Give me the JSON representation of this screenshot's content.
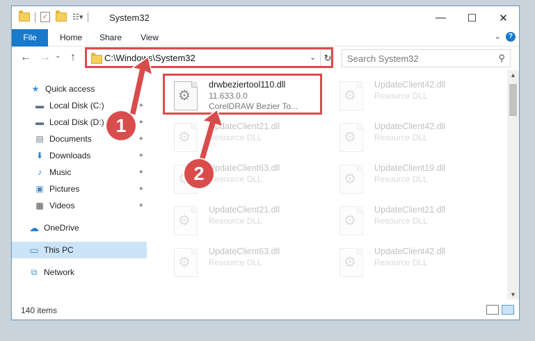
{
  "window": {
    "title": "System32",
    "controls": {
      "minimize": "—",
      "maximize": "☐",
      "close": "✕"
    }
  },
  "ribbon": {
    "tabs": [
      "File",
      "Home",
      "Share",
      "View"
    ],
    "collapse_glyph": "⌄",
    "help_glyph": "?"
  },
  "toolbar": {
    "back_glyph": "←",
    "forward_glyph": "→",
    "recent_glyph": "⌄",
    "up_glyph": "↑"
  },
  "address": {
    "path": "C:\\Windows\\System32",
    "dropdown_glyph": "⌄",
    "refresh_glyph": "↻"
  },
  "search": {
    "placeholder": "Search System32",
    "icon_glyph": "⚲"
  },
  "nav": {
    "items": [
      {
        "label": "Quick access",
        "icon": "star-icon",
        "glyph": "★",
        "color": "#3c8fd6",
        "pinned": false
      },
      {
        "label": "Local Disk (C:)",
        "icon": "drive-icon",
        "glyph": "▬",
        "color": "#5b6f82",
        "pinned": true
      },
      {
        "label": "Local Disk (D:)",
        "icon": "drive-icon",
        "glyph": "▬",
        "color": "#5b6f82",
        "pinned": true
      },
      {
        "label": "Documents",
        "icon": "documents-icon",
        "glyph": "▤",
        "color": "#6b7d8f",
        "pinned": true
      },
      {
        "label": "Downloads",
        "icon": "download-icon",
        "glyph": "⬇",
        "color": "#2b7fd0",
        "pinned": true
      },
      {
        "label": "Music",
        "icon": "music-icon",
        "glyph": "♪",
        "color": "#2b7fd0",
        "pinned": true
      },
      {
        "label": "Pictures",
        "icon": "pictures-icon",
        "glyph": "▣",
        "color": "#4c8bc0",
        "pinned": true
      },
      {
        "label": "Videos",
        "icon": "videos-icon",
        "glyph": "▦",
        "color": "#4a4a4a",
        "pinned": true
      },
      {
        "label": "OneDrive",
        "icon": "cloud-icon",
        "glyph": "☁",
        "color": "#2b7fd0",
        "pinned": false
      },
      {
        "label": "This PC",
        "icon": "computer-icon",
        "glyph": "▭",
        "color": "#3c8fd6",
        "pinned": false,
        "selected": true
      },
      {
        "label": "Network",
        "icon": "network-icon",
        "glyph": "⧉",
        "color": "#3c8fd6",
        "pinned": false
      }
    ],
    "pin_glyph": "📌"
  },
  "files": [
    {
      "name": "drwbeziertool110.dll",
      "line2": "11.633.0.0",
      "line3": "CorelDRAW Bezier To...",
      "highlighted": true
    },
    {
      "name": "UpdateClient42.dll",
      "line2": "Resource DLL"
    },
    {
      "name": "UpdateClient21.dll",
      "line2": "Resource DLL"
    },
    {
      "name": "UpdateClient42.dll",
      "line2": "Resource DLL"
    },
    {
      "name": "UpdateClient63.dll",
      "line2": "Resource DLL"
    },
    {
      "name": "UpdateClient19.dll",
      "line2": "Resource DLL"
    },
    {
      "name": "UpdateClient21.dll",
      "line2": "Resource DLL"
    },
    {
      "name": "UpdateClient21.dll",
      "line2": "Resource DLL"
    },
    {
      "name": "UpdateClient63.dll",
      "line2": "Resource DLL"
    },
    {
      "name": "UpdateClient42.dll",
      "line2": "Resource DLL"
    }
  ],
  "status": {
    "items_count": "140 items"
  },
  "annotations": {
    "step1": "1",
    "step2": "2",
    "color": "#d94c4c"
  }
}
